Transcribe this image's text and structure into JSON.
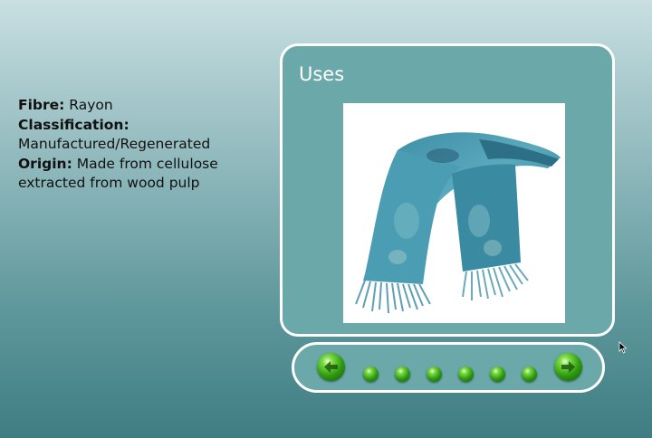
{
  "fibre_info": {
    "fibre_label": "Fibre:",
    "fibre_value": "Rayon",
    "classification_label": "Classification:",
    "classification_value": "Manufactured/Regenerated",
    "origin_label": "Origin:",
    "origin_value": "Made from cellulose extracted from wood pulp"
  },
  "panel": {
    "title": "Uses",
    "image_subject": "blue-paisley-scarf"
  },
  "navigation": {
    "prev_icon": "left-arrow-icon",
    "next_icon": "right-arrow-icon",
    "page_dot_count": 6,
    "button_color": "#2f9a10"
  },
  "colors": {
    "panel_background": "#6aa8aa",
    "panel_border": "#ffffff"
  }
}
